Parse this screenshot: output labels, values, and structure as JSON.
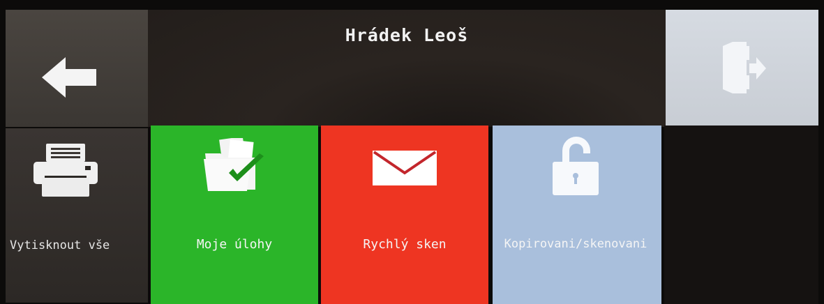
{
  "header": {
    "user_name": "Hrádek Leoš",
    "back_icon": "arrow-left-icon",
    "logout_icon": "exit-door-icon"
  },
  "tiles": [
    {
      "label": "Vytisknout vše",
      "icon": "printer-icon",
      "color": "#2f2b28"
    },
    {
      "label": "Moje úlohy",
      "icon": "folder-check-icon",
      "color": "#2bb529"
    },
    {
      "label": "Rychlý sken",
      "icon": "envelope-icon",
      "color": "#ee3522"
    },
    {
      "label": "Kopirovani/skenovani",
      "icon": "unlock-icon",
      "color": "#a9bfdc"
    }
  ]
}
